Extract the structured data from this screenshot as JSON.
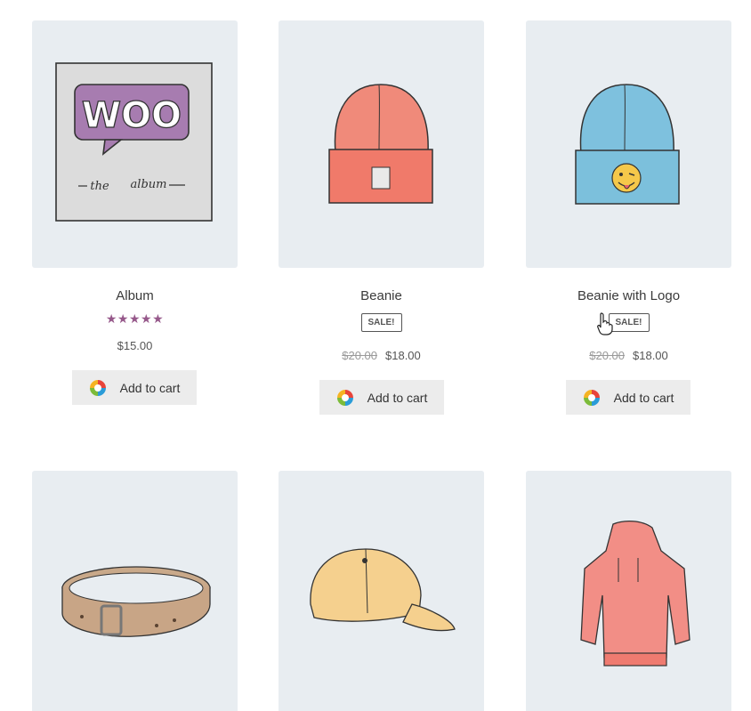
{
  "products": [
    {
      "title": "Album",
      "rating": "★★★★★",
      "price": "$15.00",
      "button_label": "Add to cart",
      "icon": "woo-album-image"
    },
    {
      "title": "Beanie",
      "sale_badge": "SALE!",
      "old_price": "$20.00",
      "price": "$18.00",
      "button_label": "Add to cart",
      "icon": "beanie-image"
    },
    {
      "title": "Beanie with Logo",
      "sale_badge": "SALE!",
      "old_price": "$20.00",
      "price": "$18.00",
      "button_label": "Add to cart",
      "icon": "beanie-logo-image"
    },
    {
      "icon": "belt-image"
    },
    {
      "icon": "cap-image"
    },
    {
      "icon": "hoodie-image"
    }
  ],
  "album_art": {
    "logo_text": "WOO",
    "caption_left": "the",
    "caption_right": "album"
  },
  "colors": {
    "thumb_bg": "#e8edf1",
    "star": "#96588a",
    "button_bg": "#ececec"
  }
}
